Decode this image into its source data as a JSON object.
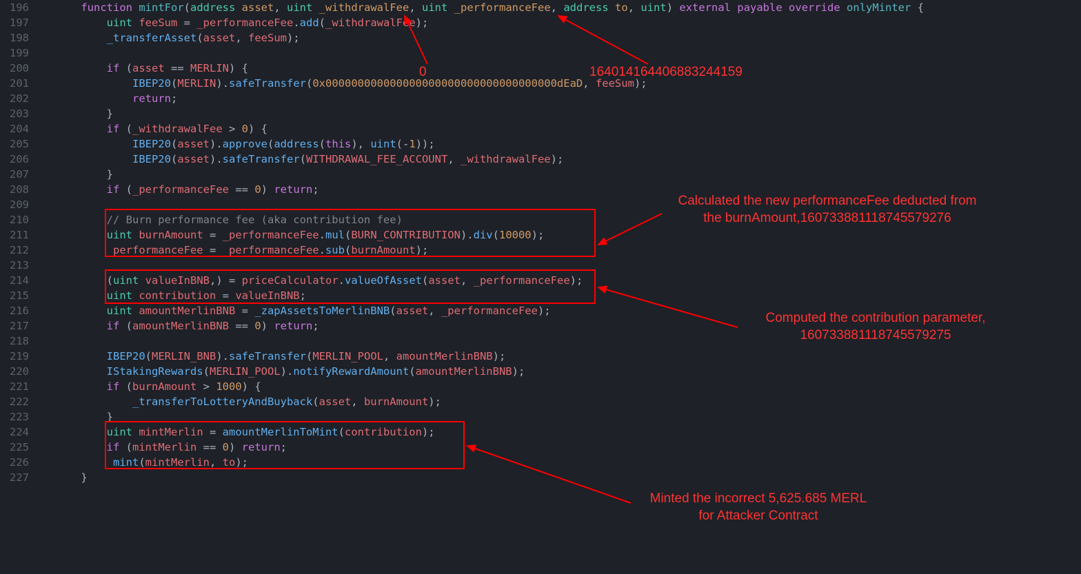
{
  "lines": {
    "start": 196,
    "end": 227
  },
  "annotations": {
    "zero": "0",
    "perfFeeValue": "164014164406883244159",
    "box1": "Calculated the new performanceFee deducted from\nthe burnAmount,160733881118745579276",
    "box2": "Computed the contribution parameter,\n160733881118745579275",
    "box3": "Minted the incorrect 5,625.685 MERL\nfor Attacker Contract"
  },
  "chart_data": null
}
